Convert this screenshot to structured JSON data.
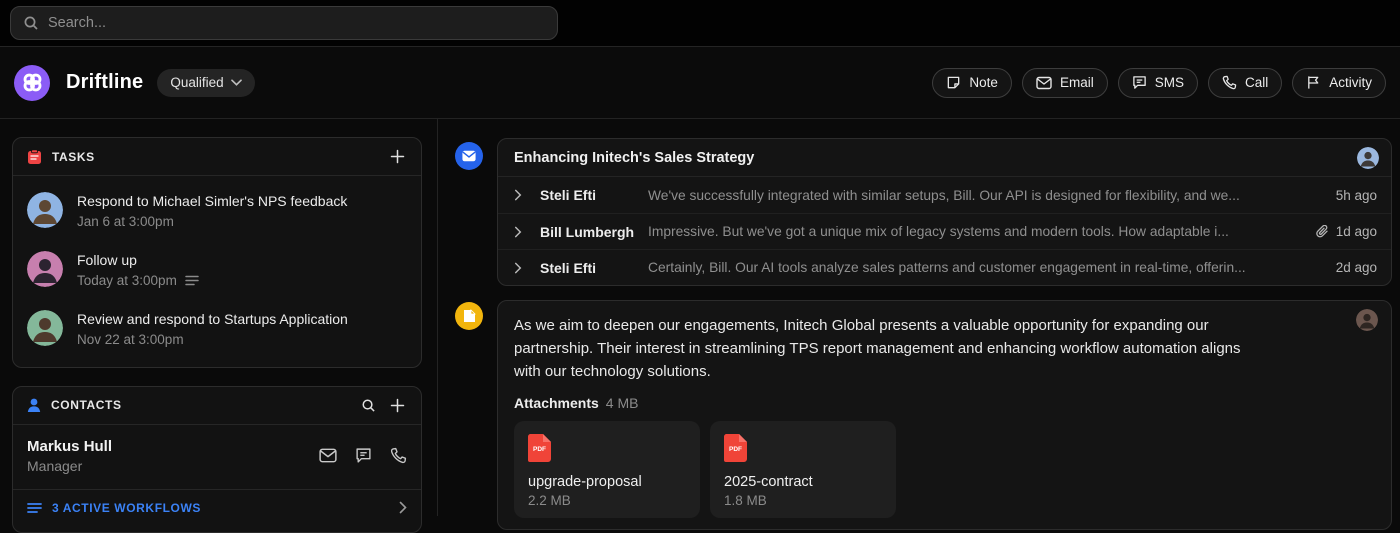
{
  "topbar": {
    "search_placeholder": "Search..."
  },
  "header": {
    "title": "Driftline",
    "status_dropdown": "Qualified",
    "actions": [
      {
        "label": "Note",
        "icon": "note-icon"
      },
      {
        "label": "Email",
        "icon": "email-icon"
      },
      {
        "label": "SMS",
        "icon": "sms-icon"
      },
      {
        "label": "Call",
        "icon": "call-icon"
      },
      {
        "label": "Activity",
        "icon": "activity-icon"
      }
    ]
  },
  "sidebar": {
    "tasks": {
      "title": "TASKS",
      "items": [
        {
          "title": "Respond to Michael Simler's NPS feedback",
          "due": "Jan 6 at 3:00pm",
          "has_note": false
        },
        {
          "title": "Follow up",
          "due": "Today at 3:00pm",
          "has_note": true
        },
        {
          "title": "Review and respond to Startups Application",
          "due": "Nov 22 at 3:00pm",
          "has_note": false
        }
      ]
    },
    "contacts": {
      "title": "CONTACTS",
      "items": [
        {
          "name": "Markus Hull",
          "role": "Manager"
        }
      ],
      "workflows_label": "3 ACTIVE WORKFLOWS",
      "active_workflows_count": 3
    }
  },
  "main": {
    "thread": {
      "subject": "Enhancing Initech's Sales Strategy",
      "messages": [
        {
          "sender": "Steli Efti",
          "preview": "We've successfully integrated with similar setups, Bill. Our API is designed for flexibility, and we...",
          "time": "5h ago",
          "has_attachment": false
        },
        {
          "sender": "Bill Lumbergh",
          "preview": "Impressive. But we've got a unique mix of legacy systems and modern tools. How adaptable i...",
          "time": "1d ago",
          "has_attachment": true
        },
        {
          "sender": "Steli Efti",
          "preview": "Certainly, Bill. Our AI tools analyze sales patterns and customer engagement in real-time, offerin...",
          "time": "2d ago",
          "has_attachment": false
        }
      ]
    },
    "note": {
      "body": "As we aim to deepen our engagements, Initech Global presents a valuable opportunity for expanding our partnership. Their interest in streamlining TPS report management and enhancing workflow automation aligns with our technology solutions.",
      "attachments_label": "Attachments",
      "attachments_total_size": "4 MB",
      "files": [
        {
          "name": "upgrade-proposal",
          "size": "2.2 MB",
          "type": "PDF"
        },
        {
          "name": "2025-contract",
          "size": "1.8 MB",
          "type": "PDF"
        }
      ]
    }
  },
  "colors": {
    "accent_purple": "#8b5cf6",
    "email_blue": "#2563eb",
    "note_yellow": "#f2b50d",
    "tasks_red": "#ef4444",
    "link_blue": "#3b82f6",
    "pdf_red": "#f04438"
  }
}
